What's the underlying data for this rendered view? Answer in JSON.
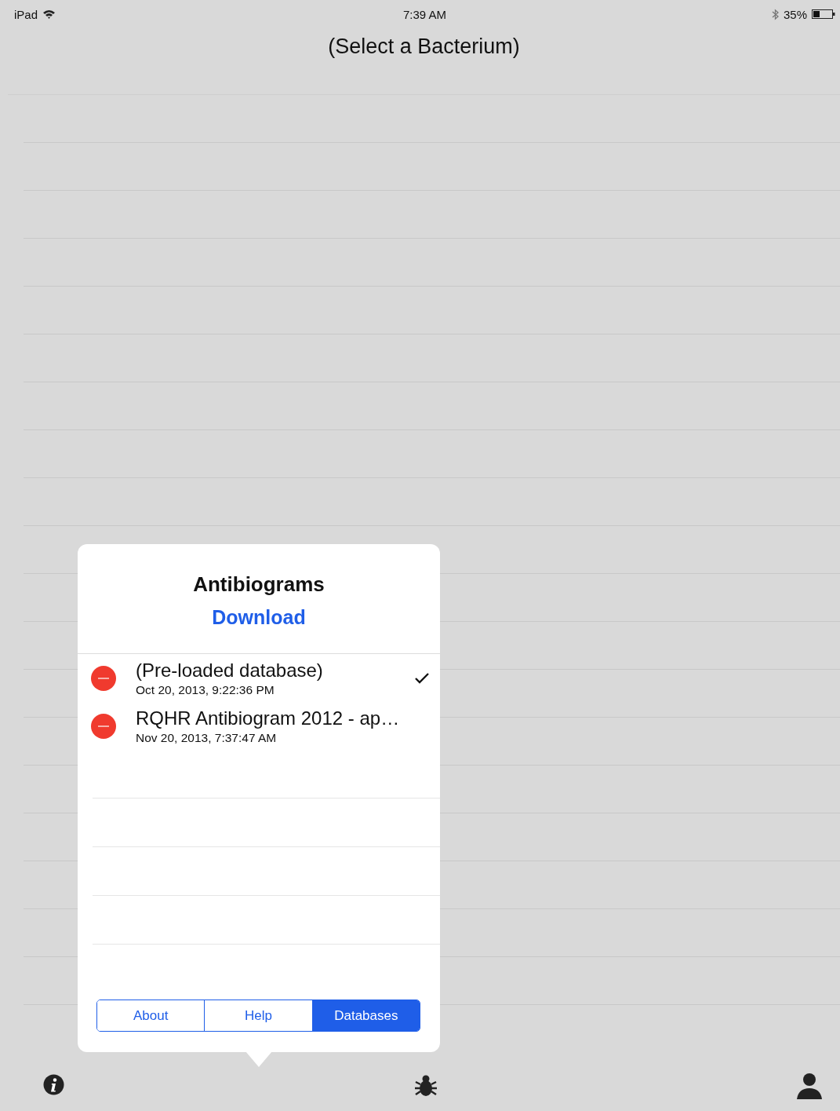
{
  "status_bar": {
    "device": "iPad",
    "time": "7:39 AM",
    "battery": "35%"
  },
  "nav": {
    "title": "(Select a Bacterium)"
  },
  "popover": {
    "title": "Antibiograms",
    "download": "Download",
    "databases": [
      {
        "name": "(Pre-loaded database)",
        "date": "Oct 20, 2013, 9:22:36 PM",
        "selected": true
      },
      {
        "name": "RQHR Antibiogram 2012 - ap…",
        "date": "Nov 20, 2013, 7:37:47 AM",
        "selected": false
      }
    ],
    "segments": [
      {
        "label": "About",
        "selected": false
      },
      {
        "label": "Help",
        "selected": false
      },
      {
        "label": "Databases",
        "selected": true
      }
    ]
  }
}
